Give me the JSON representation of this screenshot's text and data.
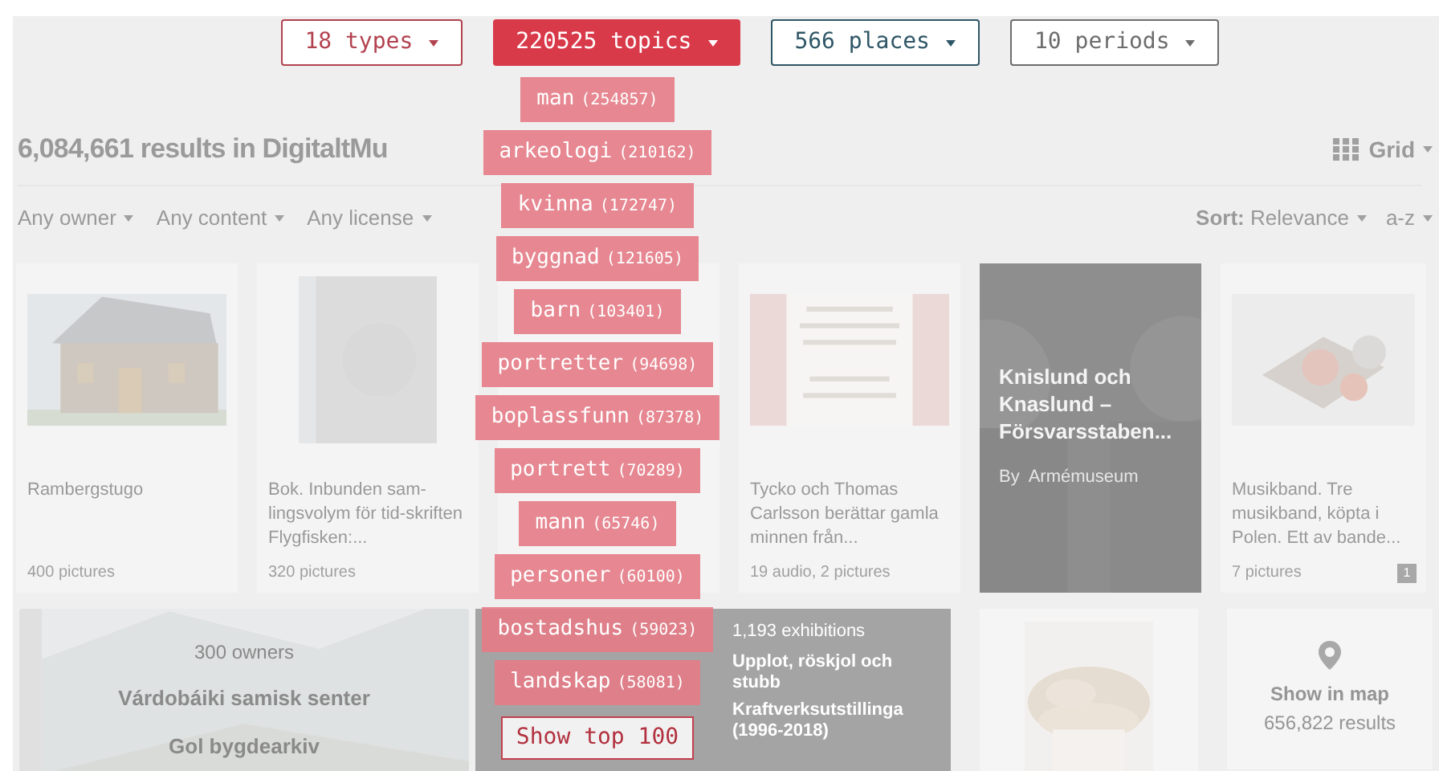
{
  "filters": [
    {
      "label": "18 types",
      "selected": false,
      "color": "#b2424f"
    },
    {
      "label": "220525 topics",
      "selected": true,
      "color": "#d93a4a"
    },
    {
      "label": "566 places",
      "selected": false,
      "color": "#2f5666"
    },
    {
      "label": "10 periods",
      "selected": false,
      "color": "#6d6d6d"
    }
  ],
  "topics": [
    {
      "name": "man",
      "count": "(254857)"
    },
    {
      "name": "arkeologi",
      "count": "(210162)"
    },
    {
      "name": "kvinna",
      "count": "(172747)"
    },
    {
      "name": "byggnad",
      "count": "(121605)"
    },
    {
      "name": "barn",
      "count": "(103401)"
    },
    {
      "name": "portretter",
      "count": "(94698)"
    },
    {
      "name": "boplassfunn",
      "count": "(87378)"
    },
    {
      "name": "portrett",
      "count": "(70289)"
    },
    {
      "name": "mann",
      "count": "(65746)"
    },
    {
      "name": "personer",
      "count": "(60100)"
    },
    {
      "name": "bostadshus",
      "count": "(59023)"
    },
    {
      "name": "landskap",
      "count": "(58081)"
    }
  ],
  "show_top": "Show top 100",
  "results_title": "6,084,661 results in DigitaltMu",
  "view": "Grid",
  "owner_filters": [
    "Any owner",
    "Any content",
    "Any license"
  ],
  "sort": {
    "label": "Sort:",
    "value": "Relevance",
    "order": "a-z"
  },
  "cards": [
    {
      "kind": "item",
      "title": "Rambergstugo",
      "meta": "400 pictures"
    },
    {
      "kind": "item",
      "title": "Bok. Inbunden sam-lingsvolym för tid-skriften Flygfisken:...",
      "meta": "320 pictures"
    },
    {
      "kind": "hidden"
    },
    {
      "kind": "item",
      "title": "Tycko och Thomas Carlsson berättar gamla minnen från...",
      "meta": "19 audio, 2 pictures"
    },
    {
      "kind": "feature",
      "title": "Knislund och Knaslund – Försvarsstaben...",
      "byline": "By  Armémuseum"
    },
    {
      "kind": "item",
      "title": "Musikband. Tre musikband, köpta i Polen. Ett av bande...",
      "meta": "7 pictures",
      "comments": "1"
    }
  ],
  "owners": {
    "count": "300 owners",
    "names": [
      "Várdobáiki samisk senter",
      "Gol bygdearkiv"
    ]
  },
  "exhibitions": {
    "count": "1,193 exhibitions",
    "names": [
      "Upplot, röskjol och stubb",
      "Kraftverksutstillinga (1996-2018)"
    ]
  },
  "map": {
    "label": "Show in map",
    "count": "656,822 results"
  }
}
